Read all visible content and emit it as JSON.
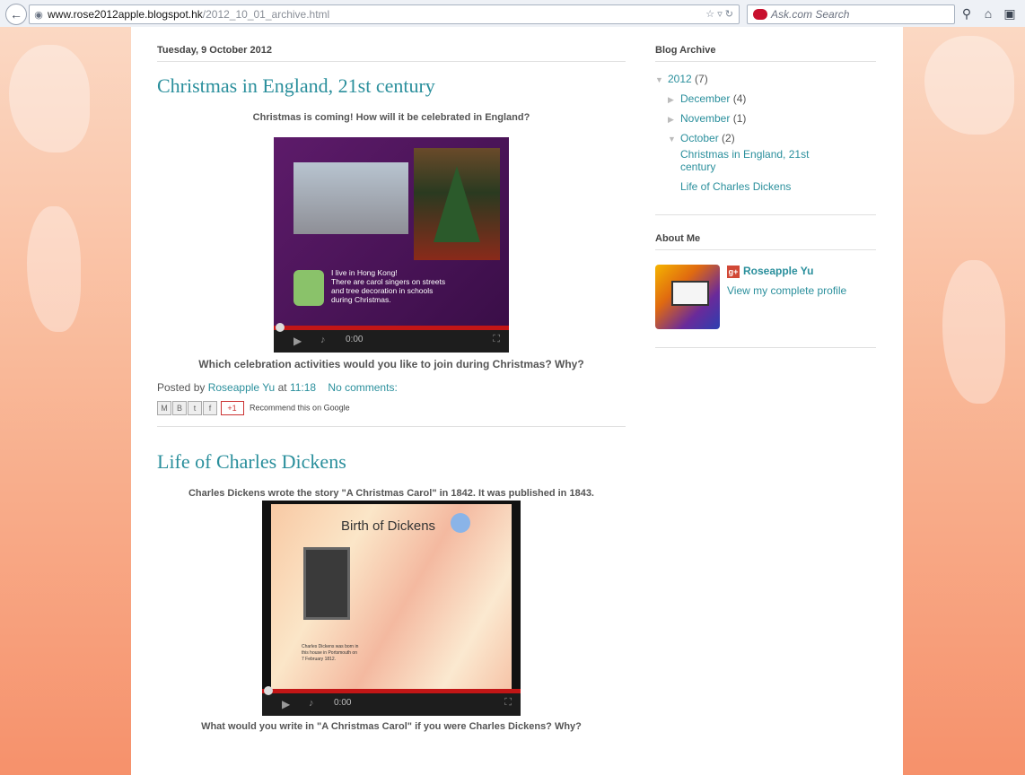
{
  "browser": {
    "url_domain": "www.rose2012apple.blogspot.hk",
    "url_path": "/2012_10_01_archive.html",
    "search_placeholder": "Ask.com Search"
  },
  "posts": [
    {
      "date": "Tuesday, 9 October 2012",
      "title": "Christmas in England, 21st century",
      "intro": "Christmas is coming! How will it be celebrated in England?",
      "video": {
        "caption_lines": [
          "I live in Hong Kong!",
          "There are carol singers on streets",
          "and tree decoration in schools",
          "during Christmas."
        ],
        "time": "0:00"
      },
      "question": "Which celebration activities would you like to join during Christmas? Why?",
      "footer": {
        "posted_by": "Posted by",
        "author": "Roseapple Yu",
        "at": "at",
        "time": "11:18",
        "comments": "No comments:"
      },
      "share": {
        "plus_one": "+1",
        "recommend": "Recommend this on Google"
      }
    },
    {
      "title": "Life of Charles Dickens",
      "intro": "Charles Dickens wrote the story \"A Christmas Carol\" in 1842. It was published in 1843.",
      "video": {
        "slide_title": "Birth of Dickens",
        "caption_lines": [
          "Charles Dickens was born in",
          "this house in Portsmouth on",
          "7 February 1812."
        ],
        "time": "0:00"
      },
      "question": "What would you write in \"A Christmas Carol\" if you were Charles Dickens? Why?"
    }
  ],
  "sidebar": {
    "archive_title": "Blog Archive",
    "year": {
      "label": "2012",
      "count": "(7)"
    },
    "months": [
      {
        "label": "December",
        "count": "(4)"
      },
      {
        "label": "November",
        "count": "(1)"
      },
      {
        "label": "October",
        "count": "(2)"
      }
    ],
    "october_posts": [
      "Christmas in England, 21st century",
      "Life of Charles Dickens"
    ],
    "about_title": "About Me",
    "profile_name": "Roseapple Yu",
    "profile_link": "View my complete profile"
  },
  "colors": {
    "accent": "#2a8f9c",
    "progress": "#c21616",
    "page_bg": "#f6916b"
  }
}
